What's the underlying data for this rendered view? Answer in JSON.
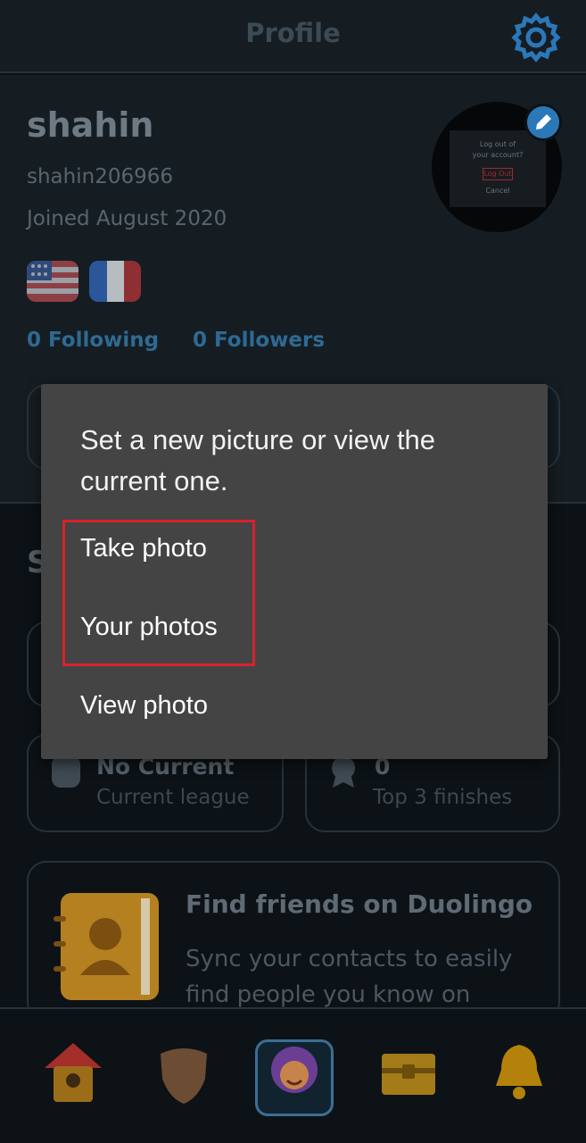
{
  "header": {
    "title": "Profile"
  },
  "profile": {
    "name": "shahin",
    "username": "shahin206966",
    "joined": "Joined August 2020",
    "following": "0 Following",
    "followers": "0 Followers",
    "avatar_dialog": {
      "question": "Log out of your account?",
      "action": "Log Out",
      "cancel": "Cancel"
    }
  },
  "stats": [
    {
      "value": "No Current",
      "label": "Current league"
    },
    {
      "value": "0",
      "label": "Top 3 finishes"
    }
  ],
  "find_friends": {
    "title": "Find friends on Duolingo",
    "description": "Sync your contacts to easily find people you know on"
  },
  "dialog": {
    "title": "Set a new picture or view the current one.",
    "options": [
      "Take photo",
      "Your photos",
      "View photo"
    ]
  },
  "colors": {
    "highlight": "#d8222c",
    "accent": "#2b78b8",
    "dialog_bg": "#444444"
  }
}
